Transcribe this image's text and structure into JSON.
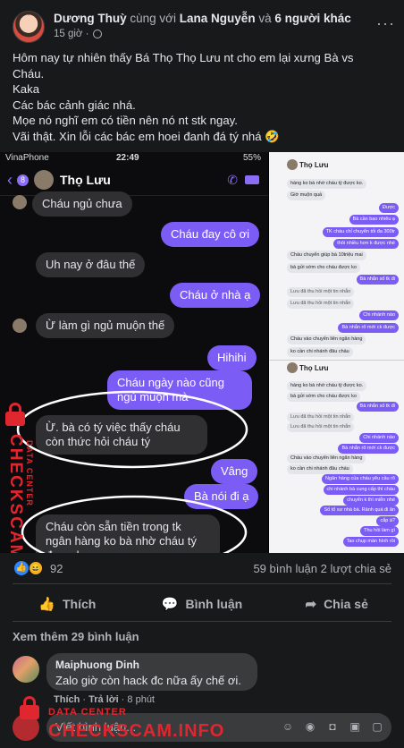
{
  "post": {
    "author": "Dương Thuỳ",
    "with_word": "cùng với",
    "tagged": "Lana Nguyễn",
    "and_word": "và",
    "others": "6 người khác",
    "time": "15 giờ ·",
    "more": "···",
    "text_lines": [
      "Hôm nay tự nhiên thấy Bá Thọ Thọ Lưu nt cho em lại xưng Bà vs",
      "Cháu.",
      "Kaka",
      "Các bác cảnh giác nhá.",
      "Mọe nó nghĩ em có tiền nên nó nt stk ngay.",
      "Vãi thật. Xin lỗi các bác em hoei đanh đá tý nhá 🤣"
    ]
  },
  "screenshot_left": {
    "carrier": "VinaPhone",
    "clock": "22:49",
    "battery": "55%",
    "unread": "8",
    "contact": "Thọ Lưu",
    "messages": [
      {
        "dir": "recv",
        "text": "Cháu ngủ chưa"
      },
      {
        "dir": "sent",
        "text": "Cháu đay cô ơi"
      },
      {
        "dir": "recv",
        "text": "Uh nay ở đâu thế"
      },
      {
        "dir": "sent",
        "text": "Cháu ở nhà ạ"
      },
      {
        "dir": "recv",
        "text": "Ừ làm gì ngủ muộn thế"
      },
      {
        "dir": "sent",
        "text": "Hihihi"
      },
      {
        "dir": "sent",
        "text": "Cháu ngày nào cũng ngủ muộn mà"
      },
      {
        "dir": "recv",
        "text": "Ừ. bà có tý việc thấy cháu còn thức hỏi cháu tý"
      },
      {
        "dir": "sent",
        "text": "Vâng"
      },
      {
        "dir": "sent",
        "text": "Bà nói đi ạ"
      },
      {
        "dir": "recv",
        "text": "Cháu còn sẵn tiền trong tk ngân hàng ko bà nhờ cháu tý được ko."
      }
    ]
  },
  "screenshot_right": {
    "contact": "Thọ Lưu",
    "messages_top": [
      {
        "dir": "r",
        "text": "hàng ko bà nhờ cháu tý được ko."
      },
      {
        "dir": "r",
        "text": "Giờ muộn quá"
      },
      {
        "dir": "s",
        "text": "Được"
      },
      {
        "dir": "s",
        "text": "Bà cần bao nhiêu ạ"
      },
      {
        "dir": "s",
        "text": "TK cháu chỉ chuyển tối đa 300tr"
      },
      {
        "dir": "s",
        "text": "thôi nhiều hơn k được nhé"
      },
      {
        "dir": "r",
        "text": "Cháu chuyển giúp bà 10triệu mai"
      },
      {
        "dir": "r",
        "text": "bà gửi sớm cho cháu được ko"
      },
      {
        "dir": "s",
        "text": "Bà nhắn số tk đi"
      },
      {
        "dir": "d",
        "text": "Lưu đã thu hồi một tin nhắn"
      },
      {
        "dir": "d",
        "text": "Lưu đã thu hồi một tin nhắn"
      },
      {
        "dir": "s",
        "text": "Chi nhánh nào"
      },
      {
        "dir": "s",
        "text": "Bà nhắn rõ mới ck được"
      },
      {
        "dir": "r",
        "text": "Cháu vào chuyển liên ngân hàng"
      },
      {
        "dir": "r",
        "text": "ko cần chi nhánh đâu cháu"
      }
    ],
    "messages_bottom": [
      {
        "dir": "r",
        "text": "hàng ko bà nhờ cháu tý được ko."
      },
      {
        "dir": "r",
        "text": "bà gửi sớm cho cháu được ko"
      },
      {
        "dir": "s",
        "text": "Bà nhắn số tk đi"
      },
      {
        "dir": "d",
        "text": "Lưu đã thu hồi một tin nhắn"
      },
      {
        "dir": "d",
        "text": "Lưu đã thu hồi một tin nhắn"
      },
      {
        "dir": "s",
        "text": "Chi nhánh nào"
      },
      {
        "dir": "s",
        "text": "Bà nhắn rõ mới ck được"
      },
      {
        "dir": "r",
        "text": "Cháu vào chuyển liên ngân hàng"
      },
      {
        "dir": "r",
        "text": "ko cần chi nhánh đâu cháu"
      },
      {
        "dir": "s",
        "text": "Ngân hàng của cháu yêu cầu rõ"
      },
      {
        "dir": "s",
        "text": "chi nhánh bà cung cấp thì cháu"
      },
      {
        "dir": "s",
        "text": "chuyển k thì miễn nhé"
      },
      {
        "dir": "s",
        "text": "Số tổ sư nhà bà. Rảnh quá đi ăn"
      },
      {
        "dir": "s",
        "text": "cắp à?"
      },
      {
        "dir": "s",
        "text": "Thu hồi làm gì"
      },
      {
        "dir": "s",
        "text": "Tao chụp màn hình rồi"
      }
    ]
  },
  "watermark": {
    "small": "DATA CENTER",
    "big": "CHECKSCAM.INFO"
  },
  "stats": {
    "reactions": "92",
    "comments_shares": "59 bình luận  2 lượt chia sẻ"
  },
  "actions": {
    "like": "Thích",
    "comment": "Bình luận",
    "share": "Chia sẻ"
  },
  "comments": {
    "see_more": "Xem thêm 29 bình luận",
    "items": [
      {
        "name": "Maiphuong Dinh",
        "text": "Zalo giờ còn hack đc nữa ấy chế ơi.",
        "like": "Thích",
        "reply": "Trả lời",
        "time": "8 phút"
      }
    ],
    "input_placeholder": "Viết bình luận..."
  }
}
